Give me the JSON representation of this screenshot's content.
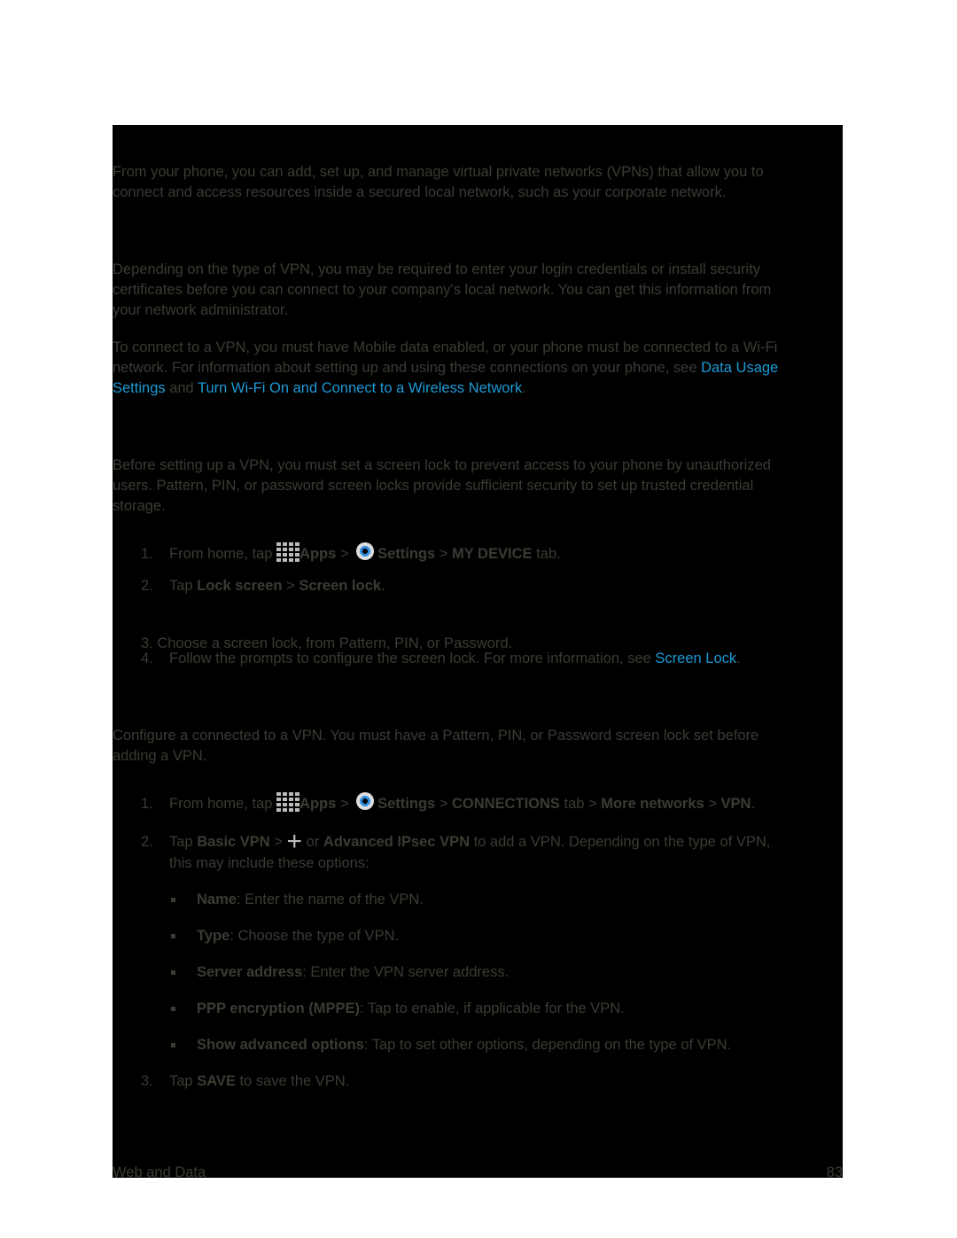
{
  "intro": [
    "From your phone, you can add, set up, and manage virtual private networks (VPNs) that allow you to",
    "connect and access resources inside a secured local network, such as your corporate network."
  ],
  "prep": [
    "Depending on the type of VPN, you may be required to enter your login credentials or install security",
    "certificates before you can connect to your company's local network. You can get this information from",
    "your network administrator."
  ],
  "connect": {
    "l1": "To connect to a VPN, you must have Mobile data enabled, or your phone must be connected to a Wi-Fi",
    "l2": "network. For information about setting up and using these connections on your phone, see ",
    "link1a": "Data Usage",
    "link1b": "Settings",
    "and": " and ",
    "link2": "Turn Wi-Fi On and Connect to a Wireless Network",
    "end": "."
  },
  "lock": [
    "Before setting up a VPN, you must set a screen lock to prevent access to your phone by unauthorized",
    "users. Pattern, PIN, or password screen locks provide sufficient security to set up trusted credential",
    "storage."
  ],
  "steps1": {
    "s1n": "1.",
    "s1a": "From home, tap ",
    "apps": "Apps",
    "gt": " > ",
    "settings": "Settings",
    "gt2": " > ",
    "mydevice": "MY DEVICE",
    "tab": " tab.",
    "s2n": "2.",
    "s2a": "Tap ",
    "lockscreen": "Lock screen",
    "screenlock": "Screen lock",
    "s3": "3. Choose a screen lock, from Pattern, PIN, or Password.",
    "s4n": "4.",
    "s4a": "Follow the prompts to configure the screen lock. For more information, see ",
    "s4link": "Screen Lock"
  },
  "config": [
    "Configure a connected to a VPN. You must have a Pattern, PIN, or Password screen lock set before",
    "adding a VPN."
  ],
  "steps2": {
    "s1n": "1.",
    "s1a": "From home, tap ",
    "apps": "Apps",
    "settings": "Settings",
    "connections": "CONNECTIONS",
    "tab": " tab > ",
    "more": "More networks",
    "vpn": "VPN",
    "s2n": "2.",
    "s2a": "Tap ",
    "basic": "Basic VPN",
    "or": " or ",
    "advanced": "Advanced IPsec VPN",
    "s2b": " to add a VPN. Depending on the type of VPN,",
    "s2c": "this may include these options:",
    "s3n": "3.",
    "s3a": "Tap ",
    "save": "SAVE",
    "s3b": " to save the VPN."
  },
  "options": [
    {
      "k": "Name",
      "v": ": Enter the name of the VPN."
    },
    {
      "k": "Type",
      "v": ": Choose the type of VPN."
    },
    {
      "k": "Server address",
      "v": ": Enter the VPN server address."
    },
    {
      "k": "PPP encryption (MPPE)",
      "v": ": Tap to enable, if applicable for the VPN."
    },
    {
      "k": "Show advanced options",
      "v": ": Tap to set other options, depending on the type of VPN."
    }
  ],
  "footer": {
    "section": "Web and Data",
    "page": "83"
  },
  "colors": {
    "text": "#3b3b33",
    "link": "#1d9ad6",
    "background": "#000000"
  }
}
